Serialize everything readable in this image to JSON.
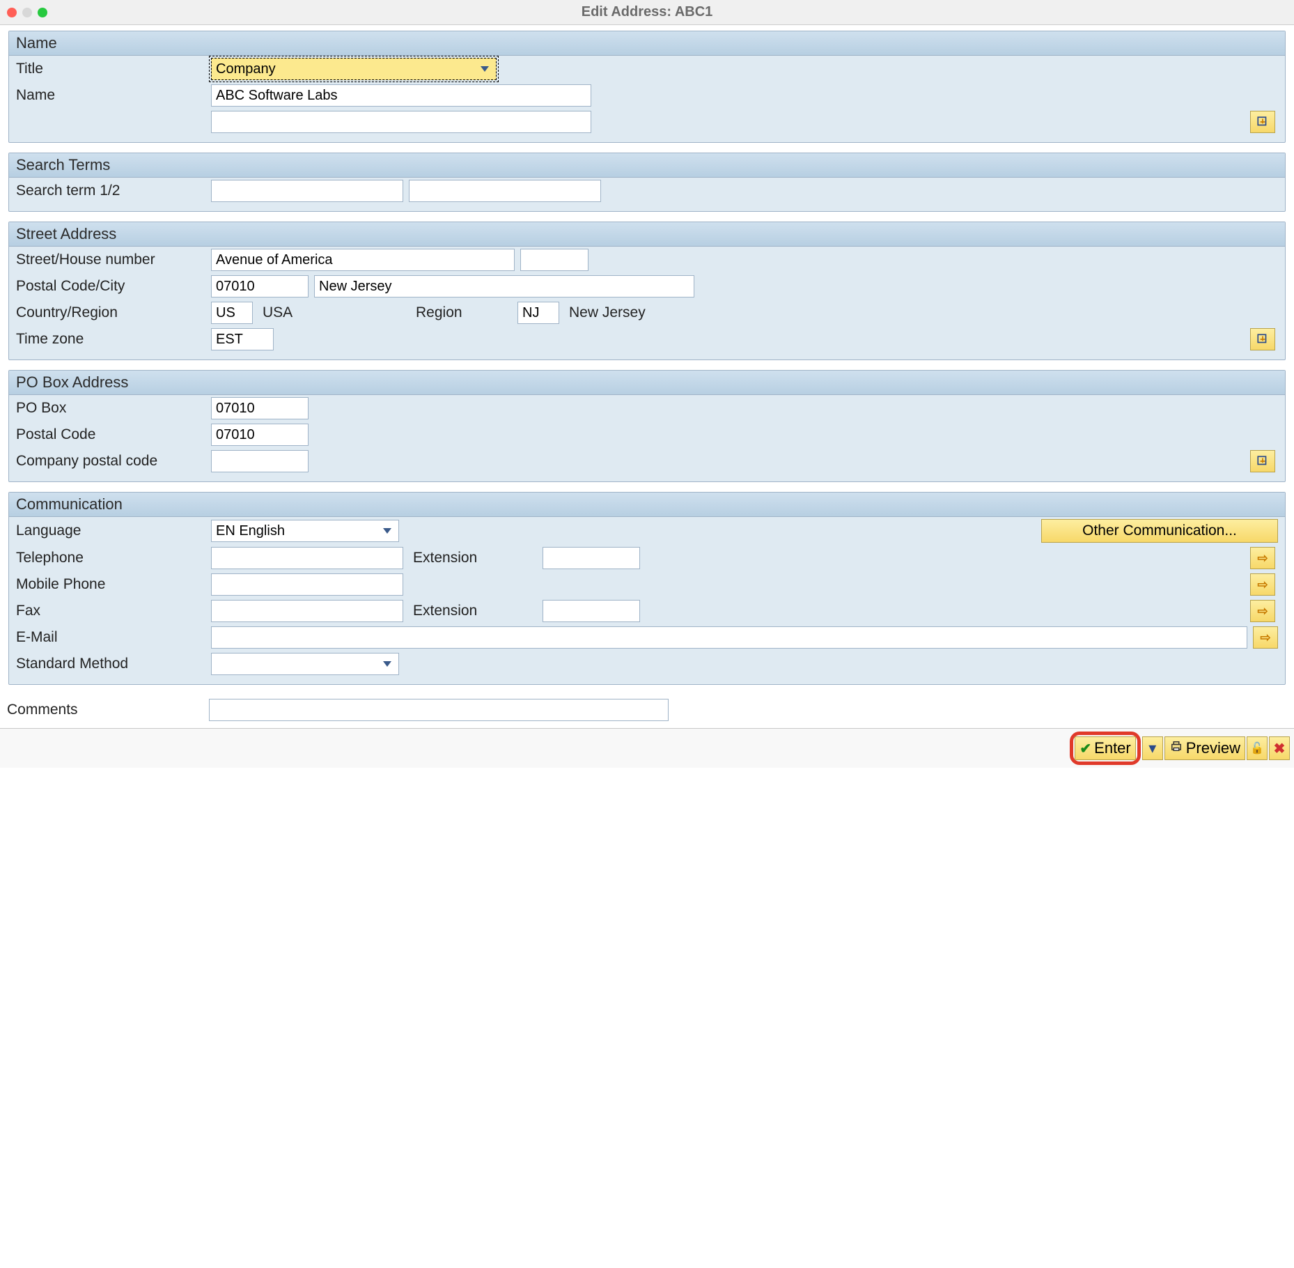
{
  "window": {
    "title": "Edit Address:  ABC1"
  },
  "sections": {
    "name": {
      "header": "Name",
      "title_label": "Title",
      "title_value": "Company",
      "name_label": "Name",
      "name_value": "ABC Software Labs",
      "name2_value": ""
    },
    "search": {
      "header": "Search Terms",
      "term_label": "Search term 1/2",
      "term1": "",
      "term2": ""
    },
    "street": {
      "header": "Street Address",
      "street_label": "Street/House number",
      "street_value": "Avenue of America",
      "house_value": "",
      "postal_label": "Postal Code/City",
      "postal_value": "07010",
      "city_value": "New Jersey",
      "country_label": "Country/Region",
      "country_value": "US",
      "country_text": "USA",
      "region_label": "Region",
      "region_value": "NJ",
      "region_text": "New Jersey",
      "tz_label": "Time zone",
      "tz_value": "EST"
    },
    "pobox": {
      "header": "PO Box Address",
      "pobox_label": "PO Box",
      "pobox_value": "07010",
      "postal_label": "Postal Code",
      "postal_value": "07010",
      "company_pc_label": "Company postal code",
      "company_pc_value": ""
    },
    "comm": {
      "header": "Communication",
      "lang_label": "Language",
      "lang_value": "EN  English",
      "other_btn": "Other Communication...",
      "tel_label": "Telephone",
      "tel_value": "",
      "ext_label": "Extension",
      "tel_ext_value": "",
      "mobile_label": "Mobile Phone",
      "mobile_value": "",
      "fax_label": "Fax",
      "fax_value": "",
      "fax_ext_value": "",
      "email_label": "E-Mail",
      "email_value": "",
      "std_label": "Standard Method",
      "std_value": ""
    }
  },
  "comments": {
    "label": "Comments",
    "value": ""
  },
  "footer": {
    "enter": "Enter",
    "preview": "Preview"
  }
}
